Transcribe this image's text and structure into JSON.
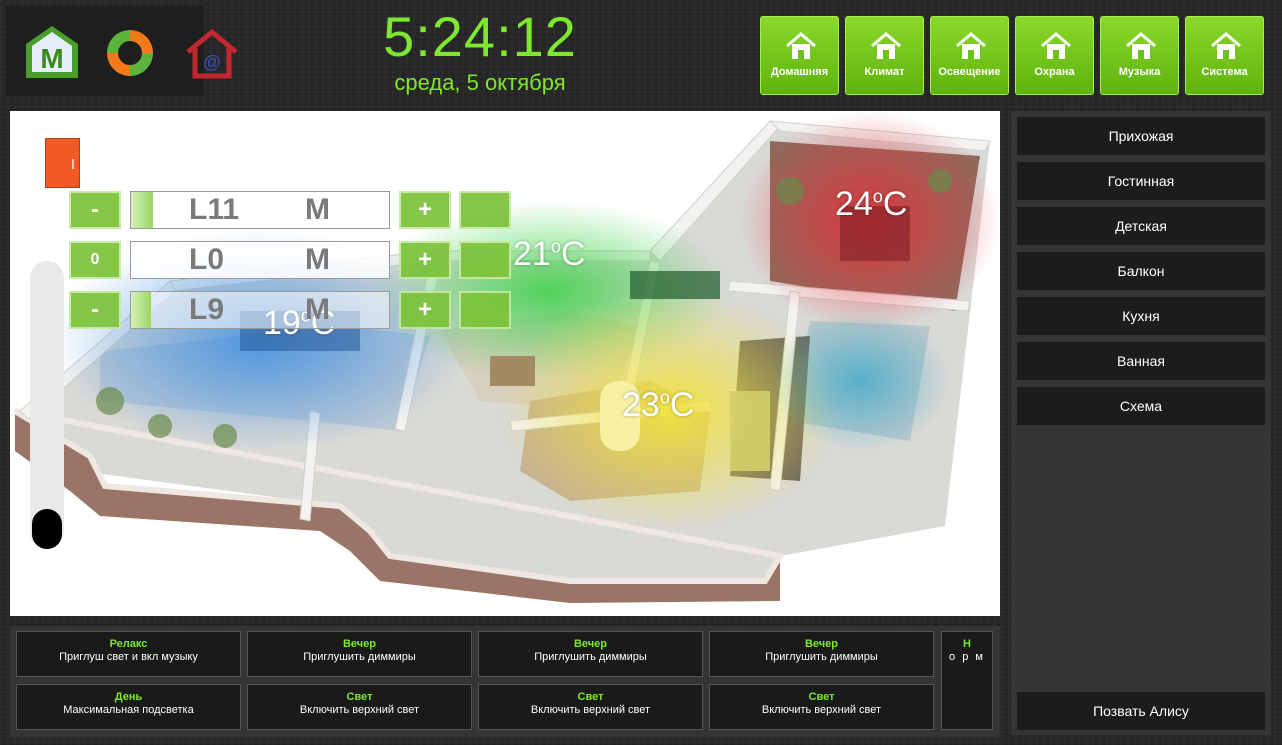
{
  "header": {
    "time": "5:24:12",
    "date": "среда,  5 октября",
    "logos": [
      "majordomo-logo",
      "sync-ring-logo",
      "email-home-logo"
    ]
  },
  "nav": [
    {
      "label": "Домашняя",
      "icon": "home-icon"
    },
    {
      "label": "Климат",
      "icon": "home-icon"
    },
    {
      "label": "Освещение",
      "icon": "home-icon"
    },
    {
      "label": "Охрана",
      "icon": "home-icon"
    },
    {
      "label": "Музыка",
      "icon": "home-icon"
    },
    {
      "label": "Система",
      "icon": "home-icon"
    }
  ],
  "plan": {
    "temps": {
      "bedroom": "24",
      "living": "21",
      "kids": "19",
      "kitchen": "23",
      "unit": "C",
      "degree": "o"
    },
    "lights": [
      {
        "minus": "-",
        "name": "L11",
        "mode": "M",
        "plus": "+"
      },
      {
        "minus": "0",
        "name": "L0",
        "mode": "M",
        "plus": "+"
      },
      {
        "minus": "-",
        "name": "L9",
        "mode": "M",
        "plus": "+"
      }
    ],
    "slider_level": 0
  },
  "rooms": {
    "items": [
      "Прихожая",
      "Гостинная",
      "Детская",
      "Балкон",
      "Кухня",
      "Ванная",
      "Схема"
    ],
    "alice": "Позвать Алису"
  },
  "scenes": {
    "row1": [
      {
        "title": "Релакс",
        "desc": "Приглуш свет и вкл музыку"
      },
      {
        "title": "Вечер",
        "desc": "Приглушить диммиры"
      },
      {
        "title": "Вечер",
        "desc": "Приглушить диммиры"
      },
      {
        "title": "Вечер",
        "desc": "Приглушить диммиры"
      }
    ],
    "row2": [
      {
        "title": "День",
        "desc": "Максимальная подсветка"
      },
      {
        "title": "Свет",
        "desc": "Включить верхний свет"
      },
      {
        "title": "Свет",
        "desc": "Включить верхний свет"
      },
      {
        "title": "Свет",
        "desc": "Включить верхний свет"
      }
    ],
    "n_box": {
      "title": "Н",
      "desc": "о р м"
    }
  },
  "colors": {
    "accent_green": "#7ee830",
    "button_green": "#6cc21a",
    "door_orange": "#f15a24",
    "hot_red": "#e8303a",
    "cold_blue": "#3c8de0",
    "warm_yellow": "#f2e23a"
  }
}
